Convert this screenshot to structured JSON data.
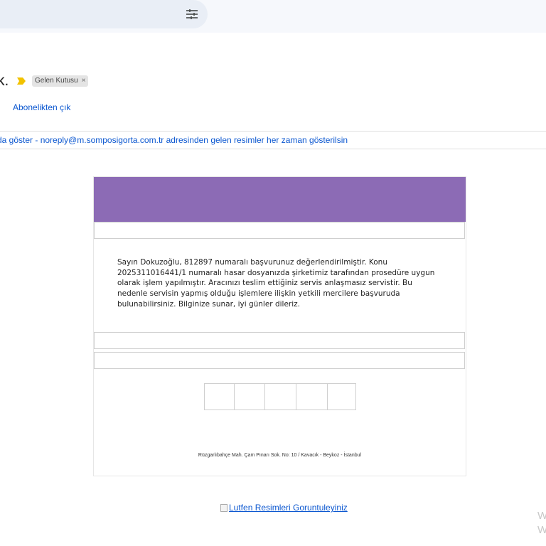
{
  "toolbar": {
    "filter_icon": "tune-icon"
  },
  "email": {
    "subject_fragment": "k.",
    "important_icon": "importance-marker-icon",
    "label": "Gelen Kutusu",
    "label_remove": "×",
    "unsubscribe": "Abonelikten çık",
    "image_bar": "da göster - noreply@m.somposigorta.com.tr adresinden gelen resimler her zaman gösterilsin"
  },
  "message": {
    "body": "Sayın Dokuzoğlu, 812897 numaralı başvurunuz değerlendirilmiştir. Konu 2025311016441/1 numaralı hasar dosyanızda şirketimiz tarafından prosedüre uygun olarak işlem yapılmıştır. Aracınızı teslim ettiğiniz servis anlaşmasız servistir. Bu nedenle servisin yapmış olduğu işlemlere ilişkin yetkili mercilere başvuruda bulunabilirsiniz. Bilginize sunar, iyi günler dileriz.",
    "address": "Rüzgarlıbahçe Mah. Çam Pınarı Sok. No: 10 / Kavacık - Beykoz - İstanbul",
    "banner_color": "#8c6bb5"
  },
  "footer": {
    "broken_image_alt": "Lutfen Resimleri Goruntuleyiniz",
    "watermark_line1": "W",
    "watermark_line2": "W"
  }
}
